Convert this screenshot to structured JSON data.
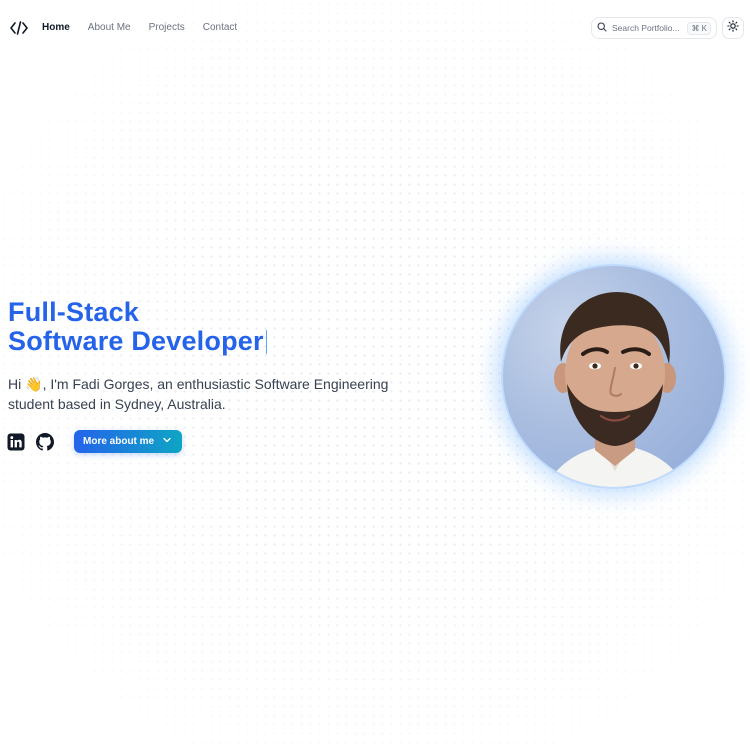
{
  "nav": {
    "links": [
      {
        "label": "Home",
        "active": true
      },
      {
        "label": "About Me",
        "active": false
      },
      {
        "label": "Projects",
        "active": false
      },
      {
        "label": "Contact",
        "active": false
      }
    ],
    "search_placeholder": "Search Portfolio...",
    "search_shortcut": "⌘ K",
    "logo_icon": "code-icon",
    "theme_icon": "sun-icon"
  },
  "hero": {
    "title_line1": "Full-Stack",
    "title_line2": "Software Developer",
    "intro_before_wave": "Hi ",
    "wave_emoji": "👋",
    "intro_after_wave": ", I'm Fadi Gorges, an enthusiastic Software Engineering student based in Sydney, Australia.",
    "cta_label": "More about me",
    "social_icons": [
      "linkedin-icon",
      "github-icon"
    ]
  },
  "colors": {
    "accent": "#2563eb",
    "accent_gradient_end": "#0ea5c4",
    "text": "#374151",
    "muted": "#6b7280"
  }
}
